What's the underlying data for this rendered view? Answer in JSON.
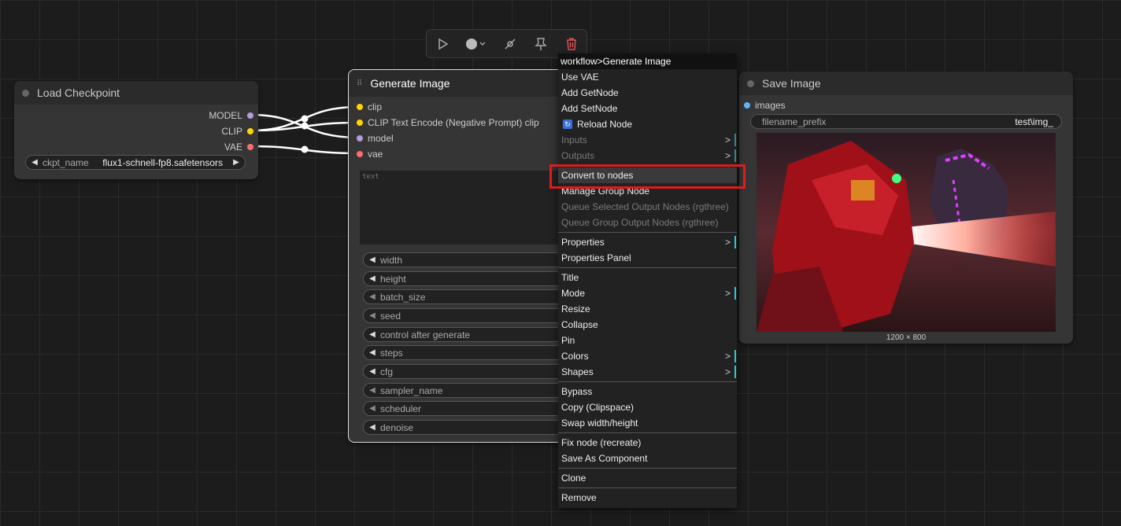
{
  "load_checkpoint": {
    "title": "Load Checkpoint",
    "outputs": [
      "MODEL",
      "CLIP",
      "VAE"
    ],
    "ckpt_name_label": "ckpt_name",
    "ckpt_name_value": "flux1-schnell-fp8.safetensors"
  },
  "generate_image": {
    "title": "Generate Image",
    "inputs": [
      "clip",
      "CLIP Text Encode (Negative Prompt) clip",
      "model",
      "vae"
    ],
    "text_placeholder": "text",
    "widgets": [
      "width",
      "height",
      "batch_size",
      "seed",
      "control after generate",
      "steps",
      "cfg",
      "sampler_name",
      "scheduler",
      "denoise"
    ]
  },
  "save_image": {
    "title": "Save Image",
    "input": "images",
    "filename_prefix_label": "filename_prefix",
    "filename_prefix_value": "test\\img_",
    "image_size": "1200 × 800"
  },
  "context_menu": {
    "title": "workflow>Generate Image",
    "items": {
      "use_vae": "Use VAE",
      "add_getnode": "Add GetNode",
      "add_setnode": "Add SetNode",
      "reload_node": "Reload Node",
      "inputs": "Inputs",
      "outputs": "Outputs",
      "convert_to_nodes": "Convert to nodes",
      "manage_group_node": "Manage Group Node",
      "queue_selected": "Queue Selected Output Nodes (rgthree)",
      "queue_group": "Queue Group Output Nodes (rgthree)",
      "properties": "Properties",
      "properties_panel": "Properties Panel",
      "title": "Title",
      "mode": "Mode",
      "resize": "Resize",
      "collapse": "Collapse",
      "pin": "Pin",
      "colors": "Colors",
      "shapes": "Shapes",
      "bypass": "Bypass",
      "copy_clipspace": "Copy (Clipspace)",
      "swap_wh": "Swap width/height",
      "fix_node": "Fix node (recreate)",
      "save_component": "Save As Component",
      "clone": "Clone",
      "remove": "Remove"
    },
    "submenu_glyph": ">"
  },
  "colors": {
    "model_slot": "#b39ddb",
    "clip_slot": "#ffd500",
    "vae_slot": "#ff6e6e",
    "image_slot": "#64b5f6",
    "highlight_border": "#e01b1b",
    "submenu_bar": "#2ec8d6",
    "delete_icon": "#e05050"
  }
}
